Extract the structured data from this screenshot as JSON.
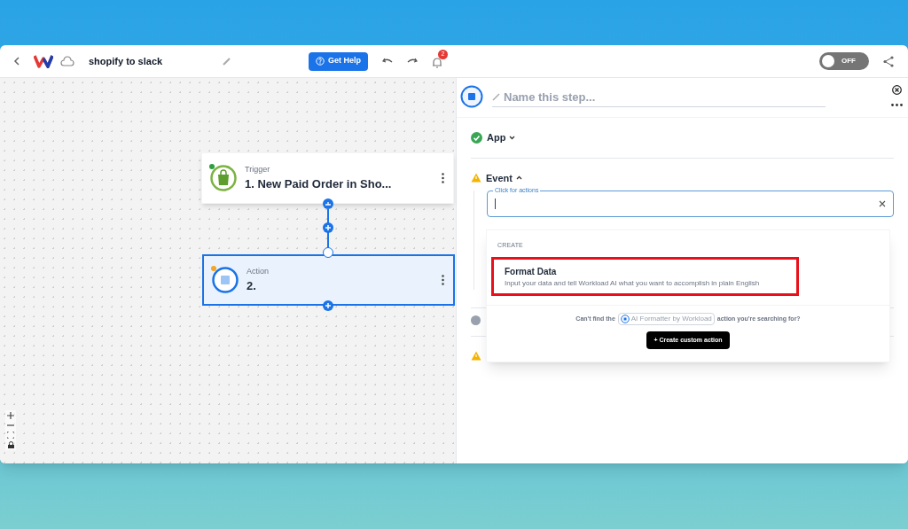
{
  "toolbar": {
    "workflow_name": "shopify to slack",
    "help_button": "Get Help",
    "notification_count": "2",
    "toggle": {
      "label": "OFF",
      "on": false
    }
  },
  "canvas": {
    "nodes": [
      {
        "kind": "trigger",
        "type_label": "Trigger",
        "title": "1. New Paid Order in Sho...",
        "selected": false,
        "color": "#2e9e3e"
      },
      {
        "kind": "action",
        "type_label": "Action",
        "title": "2.",
        "selected": true,
        "color": "#f5a623"
      }
    ]
  },
  "panel": {
    "step_name_placeholder": "Name this step...",
    "sections": [
      {
        "title": "App",
        "kind": "done",
        "expanded": false
      },
      {
        "title": "Event",
        "kind": "warning",
        "expanded": true
      }
    ],
    "event_field": {
      "label": "Click for actions"
    },
    "dropdown": {
      "group": "CREATE",
      "options": [
        {
          "title": "Format Data",
          "description": "Input your data and tell Workload AI what you want to accomplish in plain English",
          "highlighted": true
        }
      ],
      "footer_before": "Can't find the",
      "app_chip": "AI Formatter by Workload",
      "footer_after": "action you're searching for?",
      "create_button": "+ Create custom action"
    }
  }
}
